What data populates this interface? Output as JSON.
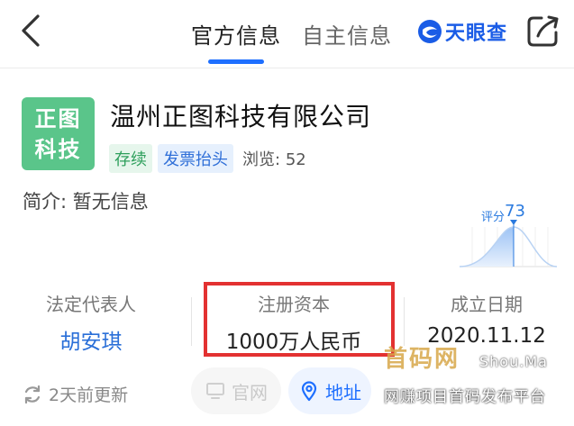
{
  "topbar": {
    "tab_official": "官方信息",
    "tab_self": "自主信息",
    "brand": "天眼查"
  },
  "company": {
    "logo_line1": "正图",
    "logo_line2": "科技",
    "name": "温州正图科技有限公司",
    "tag_status": "存续",
    "tag_invoice": "发票抬头",
    "views_label": "浏览:",
    "views_count": "52",
    "intro_label": "简介:",
    "intro_value": "暂无信息"
  },
  "score": {
    "label": "评分",
    "value": "73"
  },
  "info": {
    "legal_rep_label": "法定代表人",
    "legal_rep_value": "胡安琪",
    "capital_label": "注册资本",
    "capital_value": "1000万人民币",
    "founded_label": "成立日期",
    "founded_value": "2020.11.12"
  },
  "bottom": {
    "update_text": "2天前更新",
    "website_label": "官网",
    "address_label": "地址"
  },
  "watermark": {
    "cn": "首码网",
    "en": "Shou.Ma",
    "slogan": "网赚项目首码发布平台"
  },
  "colors": {
    "accent": "#1e6fff",
    "logo_green": "#5ac58a",
    "highlight_red": "#e33131"
  }
}
